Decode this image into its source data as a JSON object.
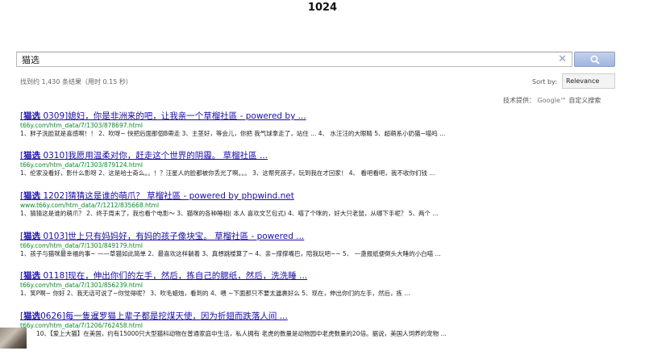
{
  "site": {
    "title": "1024"
  },
  "search": {
    "query": "猫选",
    "button_icon": "search-icon",
    "clear_icon": "close-icon"
  },
  "stats": {
    "text": "找到约 1,430 条结果（用时 0.15 秒）"
  },
  "sort": {
    "label": "Sort by:",
    "selected": "Relevance"
  },
  "powered": {
    "prefix": "技术提供：",
    "brand": "Google™",
    "suffix": "自定义搜索"
  },
  "results": [
    {
      "kw": "猫选",
      "title_rest": " 0309]媳妇，你是非洲来的吧，让我亲一个草榴社區 - powered by ...",
      "url": "t66y.com/htm_data/7/1303/878697.html",
      "snippet": "1、胖子洗脸就是喜感啊！！ 2、吹呀~ 快把后面那個B帶走 3、主茎好，等会儿，你把 我气球拿走了，站住 ... 4、 水汪汪的大眼睛 5、超萌系小奶猫~喵呜 ..."
    },
    {
      "kw": "猫选",
      "title_rest": " 0310]我愿用温柔对你，赶走这个世界的阴霾。 草榴社區 ...",
      "url": "t66y.com/htm_data/7/1303/879124.html",
      "snippet": "1、伦家没看好，影什么影呀 2、这是哈士奇么。。！？汪星人的脸都被你丢光了啊。。。 3、这帮死孩子，玩到我在才回家！ 4、 看吧看吧，我不收你们钱 ..."
    },
    {
      "kw": "猫选",
      "title_rest": " 1202]猜猜这是谁的萌爪？ 草榴社區 - powered by phpwind.net",
      "url": "www.t66y.com/htm_data/7/1212/835668.html",
      "snippet": "1、猜猜这是谁的萌爪？ 2、终于周末了，我也看个电影～ 3、猫咪的各种睡相( 本人 喜欢文艺包式) 4、喵了个咪的，好大只老鼠，从哪下手呢？ 5、两个 ..."
    },
    {
      "kw": "猫选",
      "title_rest": " 0103]世上只有妈妈好，有妈的孩子像块宝。 草榴社區 - powered ...",
      "url": "t66y.com/htm_data/7/1301/849179.html",
      "snippet": "1、孩子与猫咪最幸福的事~ ——草猫如此简单 2、最喜欢这样躺着 3、真想跳楼算了~ 4、亲~撑撑嘴巴，陪我玩吧~~ 5、 一盏报纸便倒头大睡的小白喵 ..."
    },
    {
      "kw": "猫选",
      "title_rest": " 0118]现在，伸出你们的左手，然后，拣自己的腮纸，然后，洗洗睡 ...",
      "url": "t66y.com/htm_data/7/1301/856239.html",
      "snippet": "1、笑P啊~ 你好 2、我无话可说了~你觉得呢？ 3、吹毛蜡烛，看到的 4、喂 ~下面那只不要太邋裹好么 5、现在，伸出你们的左手，然后，拣 ..."
    },
    {
      "kw": "猫选",
      "title_rest": "0626]每一隻暹罗猫上辈子都是挖煤天使，因为折翅而跌落人间 ...",
      "url": "t66y.com/htm_data/7/1206/762458.html",
      "snippet": "10、【爱上大猫】在美国，约有15000只大型猫科动物在普通家庭中生活，私人拥有 老虎的数量是动物园中老虎数量的20倍。据说，美国人饲养的宠物 ..."
    }
  ]
}
